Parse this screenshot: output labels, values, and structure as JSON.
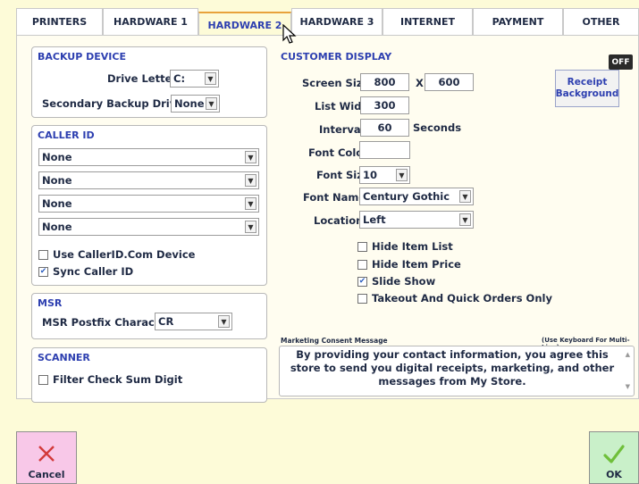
{
  "tabs": [
    "PRINTERS",
    "HARDWARE 1",
    "HARDWARE 2",
    "HARDWARE 3",
    "INTERNET",
    "PAYMENT",
    "OTHER"
  ],
  "active_tab": "HARDWARE 2",
  "backup": {
    "title": "BACKUP DEVICE",
    "drive_letter_label": "Drive Letter :",
    "drive_letter_value": "C:",
    "secondary_label": "Secondary Backup Drive:",
    "secondary_value": "None"
  },
  "caller_id": {
    "title": "CALLER ID",
    "lines": [
      "None",
      "None",
      "None",
      "None"
    ],
    "use_callerid_com": {
      "label": "Use CallerID.Com Device",
      "checked": false
    },
    "sync_caller_id": {
      "label": "Sync Caller ID",
      "checked": true
    }
  },
  "msr": {
    "title": "MSR",
    "postfix_label": "MSR Postfix Character :",
    "postfix_value": "CR"
  },
  "scanner": {
    "title": "SCANNER",
    "filter_label": "Filter Check Sum Digit",
    "filter_checked": false
  },
  "customer_display": {
    "title": "CUSTOMER DISPLAY",
    "status_badge": "OFF",
    "screen_size_label": "Screen Size",
    "screen_width": "800",
    "times": "X",
    "screen_height": "600",
    "list_width_label": "List Width",
    "list_width": "300",
    "interval_label": "Interval",
    "interval": "60",
    "seconds_label": "Seconds",
    "font_color_label": "Font Color",
    "font_color_value": "",
    "font_size_label": "Font Size",
    "font_size": "10",
    "font_name_label": "Font Name",
    "font_name": "Century Gothic",
    "location_label": "Location",
    "location": "Left",
    "receipt_bg_line1": "Receipt",
    "receipt_bg_line2": "Background",
    "options": [
      {
        "label": "Hide Item List",
        "checked": false
      },
      {
        "label": "Hide Item Price",
        "checked": false
      },
      {
        "label": "Slide Show",
        "checked": true
      },
      {
        "label": "Takeout And Quick Orders Only",
        "checked": false
      }
    ]
  },
  "marketing": {
    "label": "Marketing Consent Message",
    "hint": "(Use Keyboard For Multi-Line)",
    "message": "By providing your contact information, you agree this store to send you digital receipts, marketing, and other messages from My Store."
  },
  "buttons": {
    "cancel": "Cancel",
    "ok": "OK"
  },
  "colors": {
    "background": "#fdfbd8",
    "accent": "#2d3fb0",
    "cancel_bg": "#f8c8e8",
    "ok_bg": "#c9f0c9"
  }
}
